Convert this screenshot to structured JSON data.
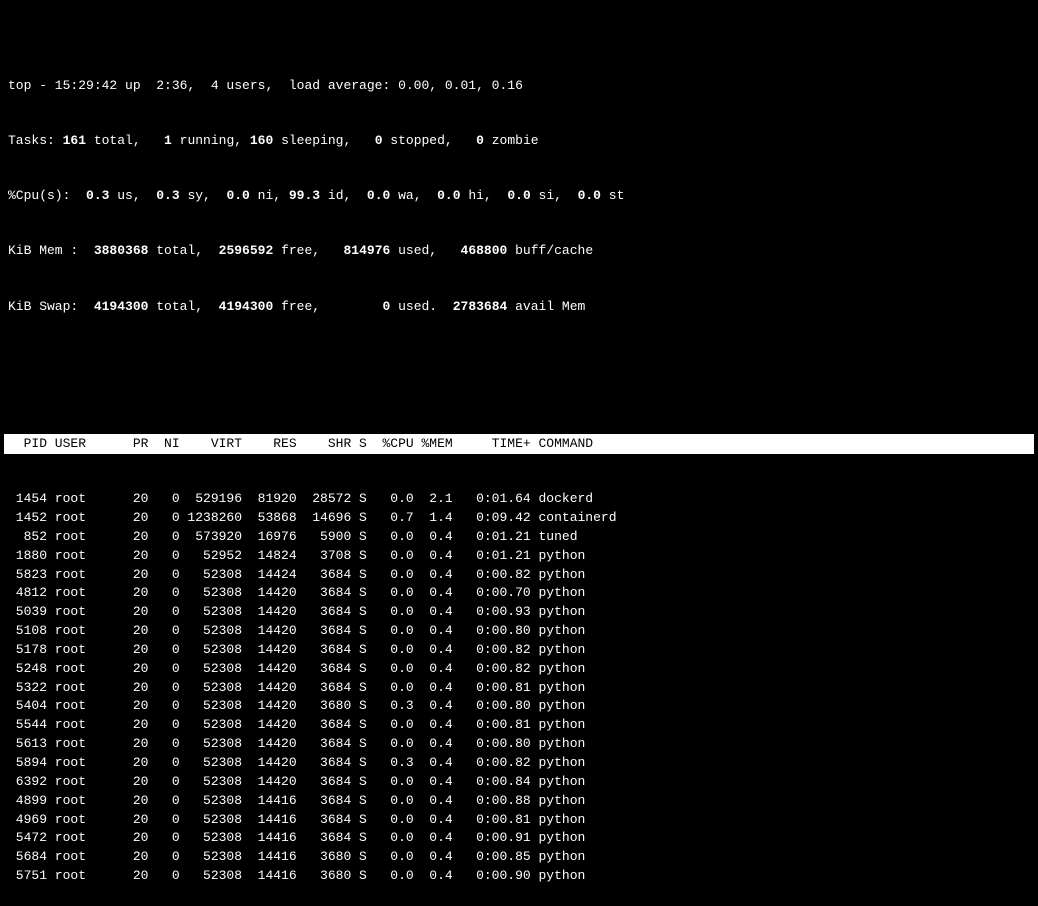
{
  "header": {
    "line1": "top - 15:29:42 up  2:36,  4 users,  load average: 0.00, 0.01, 0.16",
    "line2_prefix": "Tasks: ",
    "line2_bold1": "161",
    "line2_mid1": " total,   ",
    "line2_bold2": "1",
    "line2_mid2": " running, ",
    "line2_bold3": "160",
    "line2_mid3": " sleeping,   ",
    "line2_bold4": "0",
    "line2_mid4": " stopped,   ",
    "line2_bold5": "0",
    "line2_suffix": " zombie",
    "line3": "%Cpu(s):  ",
    "line3_b1": "0.3",
    "line3_m1": " us,  ",
    "line3_b2": "0.3",
    "line3_m2": " sy,  ",
    "line3_b3": "0.0",
    "line3_m3": " ni, ",
    "line3_b4": "99.3",
    "line3_m4": " id,  ",
    "line3_b5": "0.0",
    "line3_m5": " wa,  ",
    "line3_b6": "0.0",
    "line3_m6": " hi,  ",
    "line3_b7": "0.0",
    "line3_m7": " si,  ",
    "line3_b8": "0.0",
    "line3_suffix": " st",
    "line4": "KiB Mem :  ",
    "line4_b1": "3880368",
    "line4_m1": " total,  ",
    "line4_b2": "2596592",
    "line4_m2": " free,   ",
    "line4_b3": "814976",
    "line4_m3": " used,   ",
    "line4_b4": "468800",
    "line4_suffix": " buff/cache",
    "line5": "KiB Swap:  ",
    "line5_b1": "4194300",
    "line5_m1": " total,  ",
    "line5_b2": "4194300",
    "line5_m2": " free,        ",
    "line5_b3": "0",
    "line5_m3": " used.  ",
    "line5_b4": "2783684",
    "line5_suffix": " avail Mem"
  },
  "table_header": "  PID USER      PR  NI    VIRT    RES    SHR S  %CPU %MEM     TIME+ COMMAND",
  "rows": [
    " 1454 root      20   0  529196  81920  28572 S   0.0  2.1   0:01.64 dockerd",
    " 1452 root      20   0 1238260  53868  14696 S   0.7  1.4   0:09.42 containerd",
    "  852 root      20   0  573920  16976   5900 S   0.0  0.4   0:01.21 tuned",
    " 1880 root      20   0   52952  14824   3708 S   0.0  0.4   0:01.21 python",
    " 5823 root      20   0   52308  14424   3684 S   0.0  0.4   0:00.82 python",
    " 4812 root      20   0   52308  14420   3684 S   0.0  0.4   0:00.70 python",
    " 5039 root      20   0   52308  14420   3684 S   0.0  0.4   0:00.93 python",
    " 5108 root      20   0   52308  14420   3684 S   0.0  0.4   0:00.80 python",
    " 5178 root      20   0   52308  14420   3684 S   0.0  0.4   0:00.82 python",
    " 5248 root      20   0   52308  14420   3684 S   0.0  0.4   0:00.82 python",
    " 5322 root      20   0   52308  14420   3684 S   0.0  0.4   0:00.81 python",
    " 5404 root      20   0   52308  14420   3680 S   0.3  0.4   0:00.80 python",
    " 5544 root      20   0   52308  14420   3684 S   0.0  0.4   0:00.81 python",
    " 5613 root      20   0   52308  14420   3684 S   0.0  0.4   0:00.80 python",
    " 5894 root      20   0   52308  14420   3684 S   0.3  0.4   0:00.82 python",
    " 6392 root      20   0   52308  14420   3684 S   0.0  0.4   0:00.84 python",
    " 4899 root      20   0   52308  14416   3684 S   0.0  0.4   0:00.88 python",
    " 4969 root      20   0   52308  14416   3684 S   0.0  0.4   0:00.81 python",
    " 5472 root      20   0   52308  14416   3684 S   0.0  0.4   0:00.91 python",
    " 5684 root      20   0   52308  14416   3680 S   0.0  0.4   0:00.85 python",
    " 5751 root      20   0   52308  14416   3680 S   0.0  0.4   0:00.90 python"
  ]
}
